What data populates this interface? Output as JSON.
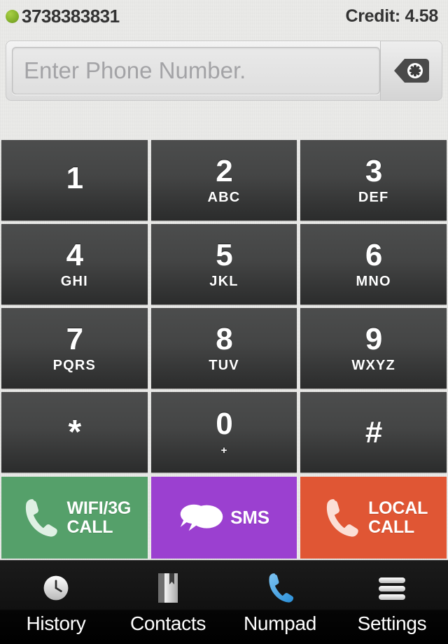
{
  "status_bar": {
    "dot_color": "#85b22c",
    "number": "3738383831",
    "credit": "Credit: 4.58"
  },
  "input": {
    "value": "",
    "placeholder": "Enter Phone Number.",
    "backspace_icon": "backspace-delete-icon"
  },
  "keypad": {
    "keys": [
      {
        "digit": "1",
        "letters": ""
      },
      {
        "digit": "2",
        "letters": "ABC"
      },
      {
        "digit": "3",
        "letters": "DEF"
      },
      {
        "digit": "4",
        "letters": "GHI"
      },
      {
        "digit": "5",
        "letters": "JKL"
      },
      {
        "digit": "6",
        "letters": "MNO"
      },
      {
        "digit": "7",
        "letters": "PQRS"
      },
      {
        "digit": "8",
        "letters": "TUV"
      },
      {
        "digit": "9",
        "letters": "WXYZ"
      },
      {
        "digit": "*",
        "letters": ""
      },
      {
        "digit": "0",
        "letters": "+"
      },
      {
        "digit": "#",
        "letters": ""
      }
    ]
  },
  "actions": [
    {
      "label_line1": "WIFI/3G",
      "label_line2": "CALL",
      "color": "#55a06a",
      "icon": "phone-handset-icon"
    },
    {
      "label_line1": "SMS",
      "label_line2": "",
      "color": "#9b40d0",
      "icon": "speech-bubbles-icon"
    },
    {
      "label_line1": "LOCAL",
      "label_line2": "CALL",
      "color": "#e05634",
      "icon": "phone-handset-icon"
    }
  ],
  "tabs": [
    {
      "label": "History",
      "icon": "clock-icon",
      "active": false
    },
    {
      "label": "Contacts",
      "icon": "book-icon",
      "active": false
    },
    {
      "label": "Numpad",
      "icon": "phone-icon",
      "active": true
    },
    {
      "label": "Settings",
      "icon": "hamburger-icon",
      "active": false
    }
  ]
}
